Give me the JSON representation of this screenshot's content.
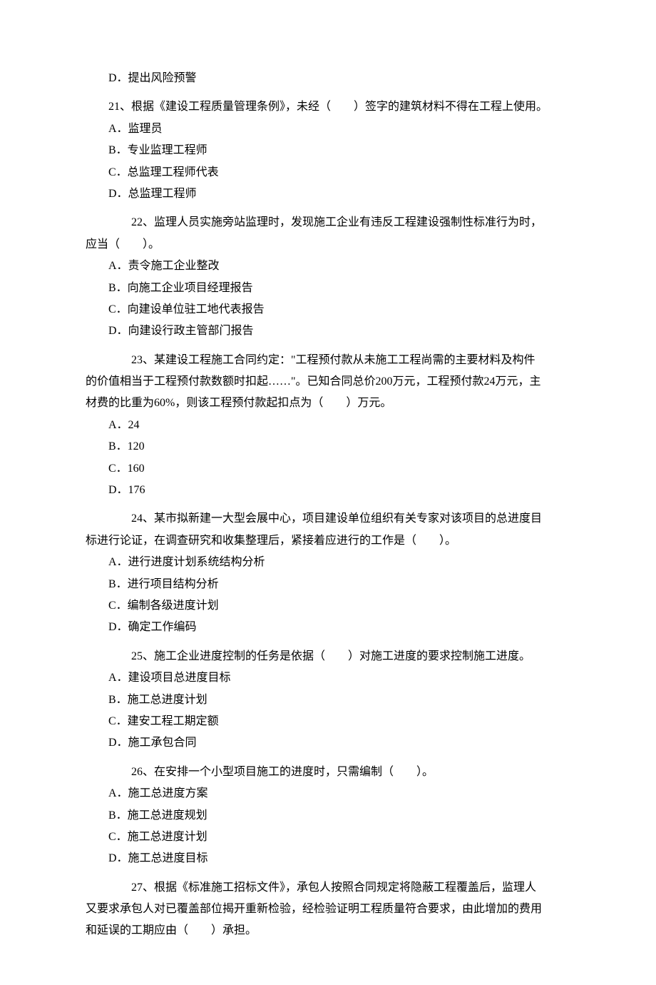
{
  "q20_d": "D．提出风险预警",
  "q21": {
    "stem": "21、根据《建设工程质量管理条例》，未经（　　）签字的建筑材料不得在工程上使用。",
    "a": "A．监理员",
    "b": "B．专业监理工程师",
    "c": "C．总监理工程师代表",
    "d": "D．总监理工程师"
  },
  "q22": {
    "stem_line1": "22、监理人员实施旁站监理时，发现施工企业有违反工程建设强制性标准行为时，",
    "stem_line2": "应当（　　）。",
    "a": "A．责令施工企业整改",
    "b": "B．向施工企业项目经理报告",
    "c": "C．向建设单位驻工地代表报告",
    "d": "D．向建设行政主管部门报告"
  },
  "q23": {
    "stem_line1": "23、某建设工程施工合同约定：\"工程预付款从未施工工程尚需的主要材料及构件",
    "stem_line2": "的价值相当于工程预付款数额时扣起……\"。已知合同总价200万元，工程预付款24万元，主",
    "stem_line3": "材费的比重为60%，则该工程预付款起扣点为（　　）万元。",
    "a": "A．24",
    "b": "B．120",
    "c": "C．160",
    "d": "D．176"
  },
  "q24": {
    "stem_line1": "24、某市拟新建一大型会展中心，项目建设单位组织有关专家对该项目的总进度目",
    "stem_line2": "标进行论证，在调查研究和收集整理后，紧接着应进行的工作是（　　）。",
    "a": "A．进行进度计划系统结构分析",
    "b": "B．进行项目结构分析",
    "c": "C．编制各级进度计划",
    "d": "D．确定工作编码"
  },
  "q25": {
    "stem": "25、施工企业进度控制的任务是依据（　　）对施工进度的要求控制施工进度。",
    "a": "A．建设项目总进度目标",
    "b": "B．施工总进度计划",
    "c": "C．建安工程工期定额",
    "d": "D．施工承包合同"
  },
  "q26": {
    "stem": "26、在安排一个小型项目施工的进度时，只需编制（　　）。",
    "a": "A．施工总进度方案",
    "b": "B．施工总进度规划",
    "c": "C．施工总进度计划",
    "d": "D．施工总进度目标"
  },
  "q27": {
    "stem_line1": "27、根据《标准施工招标文件》，承包人按照合同规定将隐蔽工程覆盖后，监理人",
    "stem_line2": "又要求承包人对已覆盖部位揭开重新检验，经检验证明工程质量符合要求，由此增加的费用",
    "stem_line3": "和延误的工期应由（　　）承担。"
  }
}
